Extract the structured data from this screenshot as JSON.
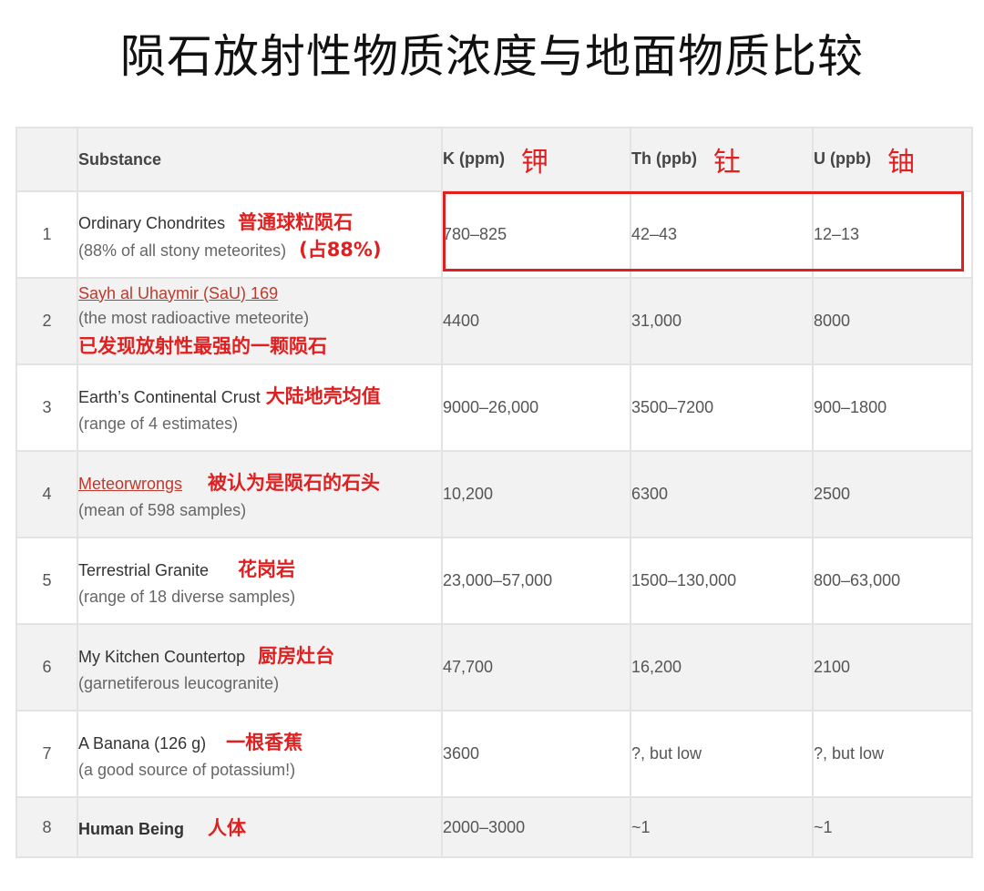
{
  "title": "陨石放射性物质浓度与地面物质比较",
  "headers": {
    "substance": "Substance",
    "k": "K (ppm)",
    "k_ann": "钾",
    "th": "Th (ppb)",
    "th_ann": "钍",
    "u": "U (ppb)",
    "u_ann": "铀"
  },
  "rows": [
    {
      "num": "1",
      "name": "Ordinary Chondrites",
      "sub": "(88% of all stony meteorites)",
      "ann": "普通球粒陨石",
      "ann2": "(占88%)",
      "k": "780–825",
      "th": "42–43",
      "u": "12–13"
    },
    {
      "num": "2",
      "name": "Sayh al Uhaymir (SaU) 169",
      "sub": "(the most radioactive meteorite)",
      "ann": "已发现放射性最强的一颗陨石",
      "k": "4400",
      "th": "31,000",
      "u": "8000"
    },
    {
      "num": "3",
      "name": "Earth’s Continental Crust",
      "sub": "(range of 4 estimates)",
      "ann": "大陆地壳均值",
      "k": "9000–26,000",
      "th": "3500–7200",
      "u": "900–1800"
    },
    {
      "num": "4",
      "name": "Meteorwrongs",
      "sub": "(mean of 598 samples)",
      "ann": "被认为是陨石的石头",
      "k": "10,200",
      "th": "6300",
      "u": "2500"
    },
    {
      "num": "5",
      "name": "Terrestrial Granite",
      "sub": "(range of 18 diverse samples)",
      "ann": "花岗岩",
      "k": "23,000–57,000",
      "th": "1500–130,000",
      "u": "800–63,000"
    },
    {
      "num": "6",
      "name": "My Kitchen Countertop",
      "sub": "(garnetiferous leucogranite)",
      "ann": "厨房灶台",
      "k": "47,700",
      "th": "16,200",
      "u": "2100"
    },
    {
      "num": "7",
      "name": "A Banana (126 g)",
      "sub": "(a good source of potassium!)",
      "ann": "一根香蕉",
      "k": "3600",
      "th": "?, but low",
      "u": "?, but low"
    },
    {
      "num": "8",
      "name": "Human Being",
      "ann": "人体",
      "k": "2000–3000",
      "th": "~1",
      "u": "~1"
    }
  ],
  "colors": {
    "annotation": "#e02020",
    "link": "#c0392b",
    "stripe": "#f2f2f2"
  }
}
